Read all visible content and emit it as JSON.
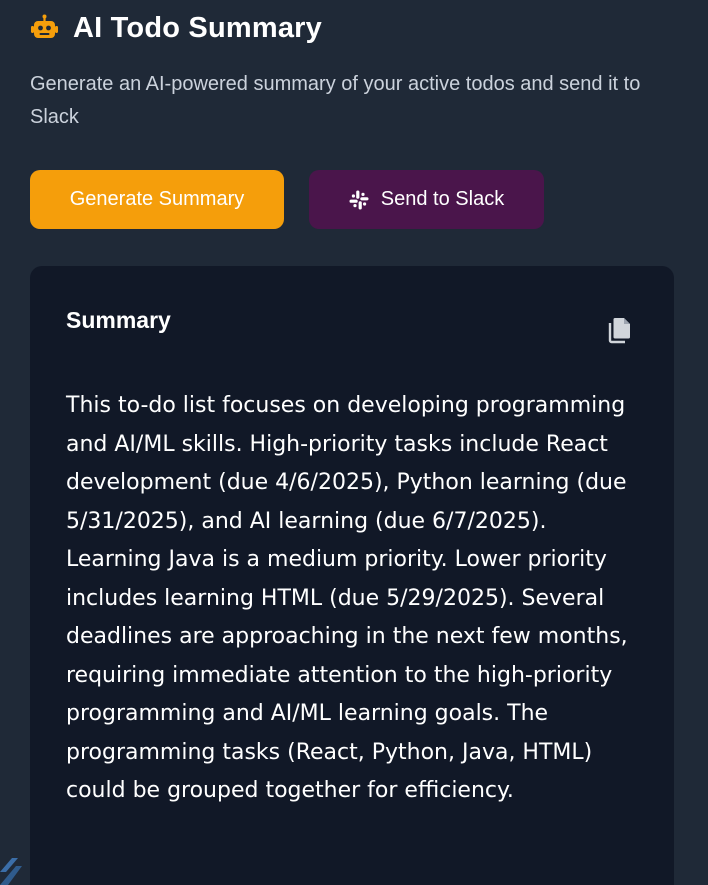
{
  "header": {
    "icon": "robot-icon",
    "title": "AI Todo Summary",
    "subtitle": "Generate an AI-powered summary of your active todos and send it to Slack"
  },
  "actions": {
    "generate_label": "Generate Summary",
    "slack_label": "Send to Slack",
    "slack_icon": "slack-icon"
  },
  "summary": {
    "heading": "Summary",
    "copy_icon": "copy-icon",
    "text": "This to-do list focuses on developing programming and AI/ML skills. High-priority tasks include React development (due 4/6/2025), Python learning (due 5/31/2025), and AI learning (due 6/7/2025). Learning Java is a medium priority. Lower priority includes learning HTML (due 5/29/2025). Several deadlines are approaching in the next few months, requiring immediate attention to the high-priority programming and AI/ML learning goals. The programming tasks (React, Python, Java, HTML) could be grouped together for efficiency."
  },
  "colors": {
    "background": "#1f2937",
    "card": "#111827",
    "generate_button": "#f59e0b",
    "slack_button": "#4a154b",
    "robot_accent": "#f59e0b"
  }
}
